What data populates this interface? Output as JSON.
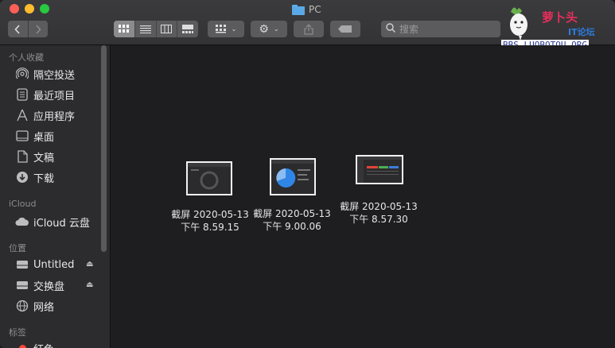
{
  "window": {
    "title": "PC"
  },
  "toolbar": {
    "back_icon": "chevron-left-icon",
    "forward_icon": "chevron-right-icon",
    "search_placeholder": "搜索"
  },
  "watermark": {
    "title": "萝卜头",
    "subtitle": "IT论坛",
    "url": "BBS.LUOBOTOU.ORG"
  },
  "sidebar": {
    "favorites_title": "个人收藏",
    "favorites": [
      {
        "label": "隔空投送",
        "icon": "airdrop-icon"
      },
      {
        "label": "最近项目",
        "icon": "recents-icon"
      },
      {
        "label": "应用程序",
        "icon": "applications-icon"
      },
      {
        "label": "桌面",
        "icon": "desktop-icon"
      },
      {
        "label": "文稿",
        "icon": "documents-icon"
      },
      {
        "label": "下载",
        "icon": "downloads-icon"
      }
    ],
    "icloud_title": "iCloud",
    "icloud": [
      {
        "label": "iCloud 云盘",
        "icon": "cloud-icon"
      }
    ],
    "locations_title": "位置",
    "locations": [
      {
        "label": "Untitled",
        "icon": "drive-icon"
      },
      {
        "label": "交换盘",
        "icon": "drive-icon"
      },
      {
        "label": "网络",
        "icon": "network-icon"
      }
    ],
    "tags_title": "标签",
    "tags": [
      {
        "label": "红色",
        "color": "#ff453a"
      }
    ]
  },
  "files": [
    {
      "line1": "截屏 2020-05-13",
      "line2": "下午 8.59.15"
    },
    {
      "line1": "截屏 2020-05-13",
      "line2": "下午 9.00.06"
    },
    {
      "line1": "截屏 2020-05-13",
      "line2": "下午 8.57.30"
    }
  ],
  "colors": {
    "accent": "#5aa9e6",
    "sidebar_bg": "#2c2c2f",
    "content_bg": "#1e1e20"
  }
}
